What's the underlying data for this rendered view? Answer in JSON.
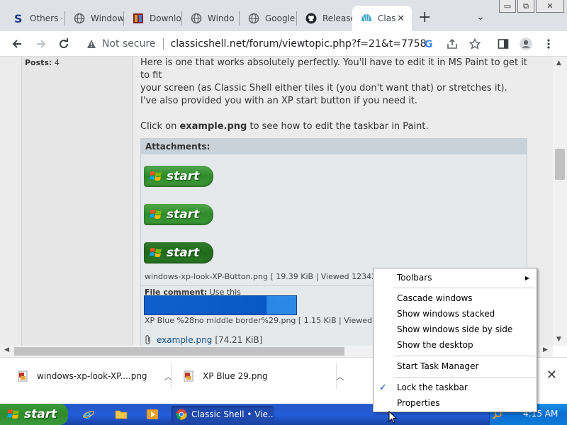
{
  "browser": {
    "tabs": [
      {
        "title": "Others -",
        "icon": "s-logo-icon"
      },
      {
        "title": "Window",
        "icon": "globe-icon"
      },
      {
        "title": "Downlo",
        "icon": "archive-icon"
      },
      {
        "title": "Windo",
        "icon": "globe-icon"
      },
      {
        "title": "Google",
        "icon": "globe-icon"
      },
      {
        "title": "Release",
        "icon": "github-icon"
      },
      {
        "title": "Clas",
        "icon": "shell-icon",
        "active": true
      }
    ],
    "new_tab": "+",
    "tab_list": "⌄",
    "window_controls": {
      "minimize": "▭",
      "restore": "⧉",
      "close": "✕"
    },
    "security_label": "Not secure",
    "url": "classicshell.net/forum/viewtopic.php?f=21&t=7758"
  },
  "post": {
    "profile": {
      "posts_label": "Posts:",
      "posts_value": "4"
    },
    "lines": [
      "Here is one that works absolutely perfectly. You'll have to edit it in MS Paint to get it to fit",
      "your screen (as Classic Shell either tiles it (you don't want that) or stretches it).",
      "I've also provided you with an XP start button if you need it."
    ],
    "click_prefix": "Click on ",
    "click_file": "example.png",
    "click_suffix": " to see how to edit the taskbar in Paint.",
    "attachments_header": "Attachments:",
    "start_label": "start",
    "file1_info": "windows-xp-look-XP-Button.png [ 19.39 KiB | Viewed 123422 ti",
    "file_comment_label": "File comment:",
    "file_comment_text": "Use this",
    "file2_info": "XP Blue %28no middle border%29.png [ 1.15 KiB | Viewed 123",
    "example_link": "example.png",
    "example_size": "[74.21 KiB]"
  },
  "downloads": {
    "items": [
      {
        "name": "windows-xp-look-XP....png"
      },
      {
        "name": "XP Blue 29.png"
      }
    ],
    "close": "✕"
  },
  "taskbar": {
    "start_label": "start",
    "task_button": "Classic Shell • Vie...",
    "clock": "4:15 AM"
  },
  "context_menu": {
    "toolbars": "Toolbars",
    "cascade": "Cascade windows",
    "stacked": "Show windows stacked",
    "side_by_side": "Show windows side by side",
    "desktop": "Show the desktop",
    "task_manager": "Start Task Manager",
    "lock": "Lock the taskbar",
    "lock_checked": true,
    "properties": "Properties"
  }
}
